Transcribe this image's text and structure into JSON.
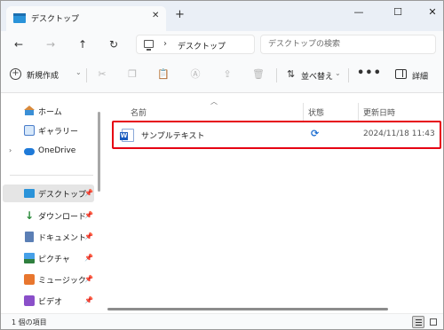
{
  "window": {
    "tab_title": "デスクトップ",
    "tab_close": "✕",
    "new_tab": "+",
    "controls": {
      "minimize": "—",
      "maximize": "☐",
      "close": "✕"
    }
  },
  "address": {
    "back": "←",
    "forward": "→",
    "up": "↑",
    "refresh": "↻",
    "separator": "›",
    "breadcrumb": "デスクトップ",
    "search_placeholder": "デスクトップの検索"
  },
  "commandbar": {
    "new_label": "新規作成",
    "chevron": "⌄",
    "tools": [
      "scissors-icon",
      "copy-icon",
      "paste-icon",
      "rename-icon",
      "share-icon",
      "delete-icon"
    ],
    "sort_label": "並べ替え",
    "more": "•••",
    "details_label": "詳細"
  },
  "sidebar": {
    "items": [
      {
        "label": "ホーム",
        "icon": "home-icon"
      },
      {
        "label": "ギャラリー",
        "icon": "gallery-icon"
      },
      {
        "label": "OneDrive",
        "icon": "onedrive-icon",
        "expandable": true
      },
      {
        "label": "デスクトップ",
        "icon": "desktop-icon",
        "selected": true,
        "pinned": true
      },
      {
        "label": "ダウンロード",
        "icon": "download-icon",
        "pinned": true
      },
      {
        "label": "ドキュメント",
        "icon": "documents-icon",
        "pinned": true
      },
      {
        "label": "ピクチャ",
        "icon": "pictures-icon",
        "pinned": true
      },
      {
        "label": "ミュージック",
        "icon": "music-icon",
        "pinned": true
      },
      {
        "label": "ビデオ",
        "icon": "videos-icon",
        "pinned": true
      }
    ]
  },
  "columns": {
    "name": "名前",
    "status": "状態",
    "modified": "更新日時"
  },
  "files": [
    {
      "name": "サンプルテキスト",
      "icon": "word-document-icon",
      "status_icon": "sync-icon",
      "modified": "2024/11/18 11:43"
    }
  ],
  "statusbar": {
    "item_count": "1 個の項目"
  },
  "colors": {
    "highlight": "#e60012",
    "accent": "#1f6fd1",
    "titlebar": "#eaeff6"
  }
}
